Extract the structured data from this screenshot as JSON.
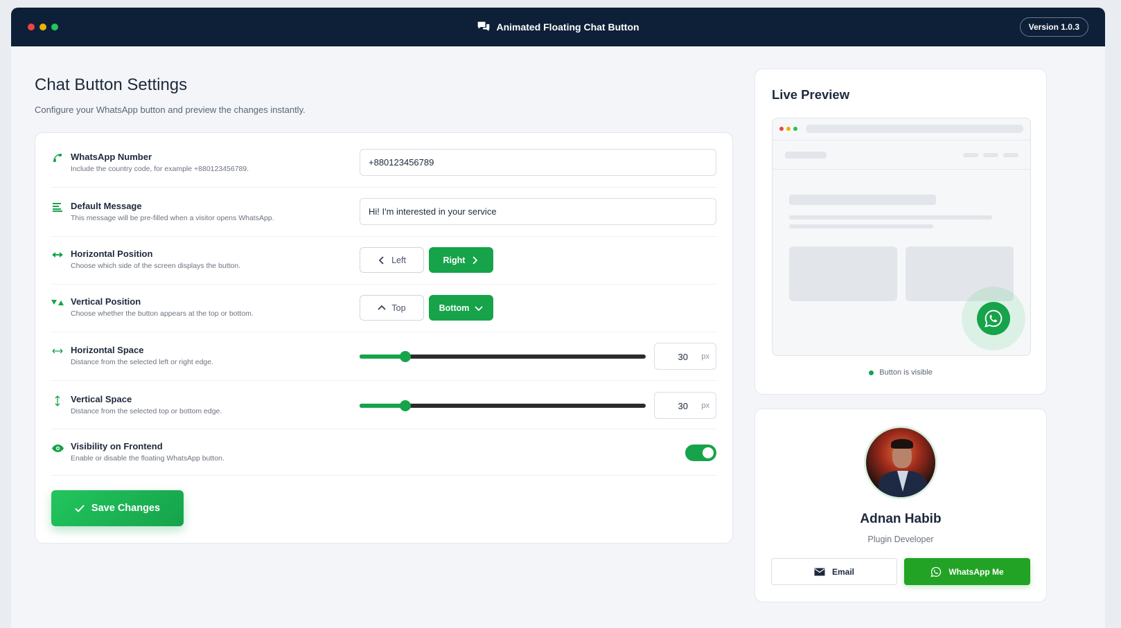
{
  "window": {
    "title": "Animated Floating Chat Button",
    "version": "Version 1.0.3",
    "dot_colors": [
      "#ef4444",
      "#eab308",
      "#22c55e"
    ]
  },
  "settings": {
    "heading": "Chat Button Settings",
    "subheading": "Configure your WhatsApp button and preview the changes instantly.",
    "whatsapp_number": {
      "label": "WhatsApp Number",
      "description": "Include the country code, for example +880123456789.",
      "value": "+880123456789",
      "icon": "phone-icon"
    },
    "default_message": {
      "label": "Default Message",
      "description": "This message will be pre-filled when a visitor opens WhatsApp.",
      "value": "Hi! I'm interested in your service",
      "icon": "lines-icon"
    },
    "horizontal_position": {
      "label": "Horizontal Position",
      "description": "Choose which side of the screen displays the button.",
      "options": [
        "Left",
        "Right"
      ],
      "selected": "Right",
      "icon": "horizontal-arrows-icon"
    },
    "vertical_position": {
      "label": "Vertical Position",
      "description": "Choose whether the button appears at the top or bottom.",
      "options": [
        "Top",
        "Bottom"
      ],
      "selected": "Bottom",
      "icon": "vertical-arrows-icon"
    },
    "horizontal_space": {
      "label": "Horizontal Space",
      "description": "Distance from the selected left or right edge.",
      "value": "30",
      "unit": "px",
      "slider_fraction": 0.16,
      "icon": "horizontal-space-icon"
    },
    "vertical_space": {
      "label": "Vertical Space",
      "description": "Distance from the selected top or bottom edge.",
      "value": "30",
      "unit": "px",
      "slider_fraction": 0.16,
      "icon": "vertical-space-icon"
    },
    "visibility": {
      "label": "Visibility on Frontend",
      "description": "Enable or disable the floating WhatsApp button.",
      "enabled": true,
      "icon": "eye-icon"
    },
    "save_label": "Save Changes"
  },
  "preview": {
    "heading": "Live Preview",
    "status": "Button is visible"
  },
  "profile": {
    "name": "Adnan Habib",
    "role": "Plugin Developer",
    "email_label": "Email",
    "whatsapp_label": "WhatsApp Me"
  },
  "colors": {
    "accent": "#16a34a",
    "titlebar": "#0e1f38"
  }
}
